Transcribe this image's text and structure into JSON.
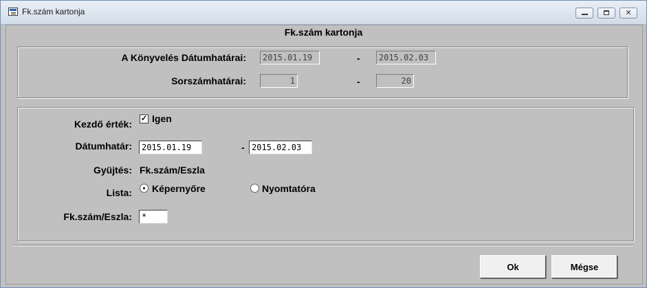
{
  "window": {
    "title": "Fk.szám kartonja",
    "icon": "form-window-icon"
  },
  "form": {
    "title": "Fk.szám kartonja"
  },
  "group1": {
    "date_range_label": "A Könyvelés  Dátumhatárai:",
    "date_from": "2015.01.19",
    "date_separator": "-",
    "date_to": "2015.02.03",
    "serial_range_label": "Sorszámhatárai:",
    "serial_from": "1",
    "serial_separator": "-",
    "serial_to": "20"
  },
  "group2": {
    "initial_value_label": "Kezdő érték:",
    "initial_value_checked": true,
    "initial_value_option": "Igen",
    "date_limit_label": "Dátumhatár:",
    "date_limit_from": "2015.01.19",
    "date_limit_separator": "-",
    "date_limit_to": "2015.02.03",
    "collection_label": "Gyüjtés:",
    "collection_value": "Fk.szám/Eszla",
    "list_label": "Lista:",
    "list_options": [
      {
        "label": "Képernyőre",
        "selected": true
      },
      {
        "label": "Nyomtatóra",
        "selected": false
      }
    ],
    "fk_label": "Fk.szám/Eszla:",
    "fk_value": "*"
  },
  "buttons": {
    "ok": "Ok",
    "cancel": "Mégse"
  }
}
